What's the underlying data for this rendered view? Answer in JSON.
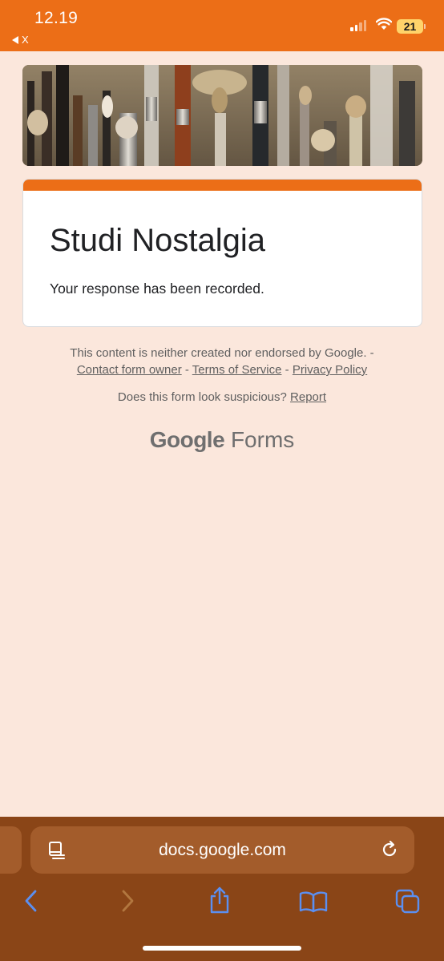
{
  "status_bar": {
    "time": "12.19",
    "back_app_label": "X",
    "battery_level": "21"
  },
  "form": {
    "title": "Studi Nostalgia",
    "confirmation_message": "Your response has been recorded."
  },
  "footer": {
    "disclaimer": "This content is neither created nor endorsed by Google. -",
    "links": {
      "contact": "Contact form owner",
      "terms": "Terms of Service",
      "privacy": "Privacy Policy"
    },
    "separator": "-",
    "suspicious_question": "Does this form look suspicious?",
    "report_link": "Report",
    "brand_google": "Google",
    "brand_forms": "Forms"
  },
  "browser": {
    "url": "docs.google.com"
  },
  "colors": {
    "accent": "#ec6e17",
    "page_background": "#fbe7dc",
    "toolbar": "#8a4517",
    "toolbar_icons": "#5b8ff0"
  },
  "icons": {
    "reader": "reader-mode-icon",
    "reload": "reload-icon",
    "back": "chevron-left-icon",
    "forward": "chevron-right-icon",
    "share": "share-icon",
    "bookmarks": "book-icon",
    "tabs": "tabs-icon",
    "wifi": "wifi-icon",
    "signal": "signal-icon",
    "battery": "battery-icon"
  }
}
